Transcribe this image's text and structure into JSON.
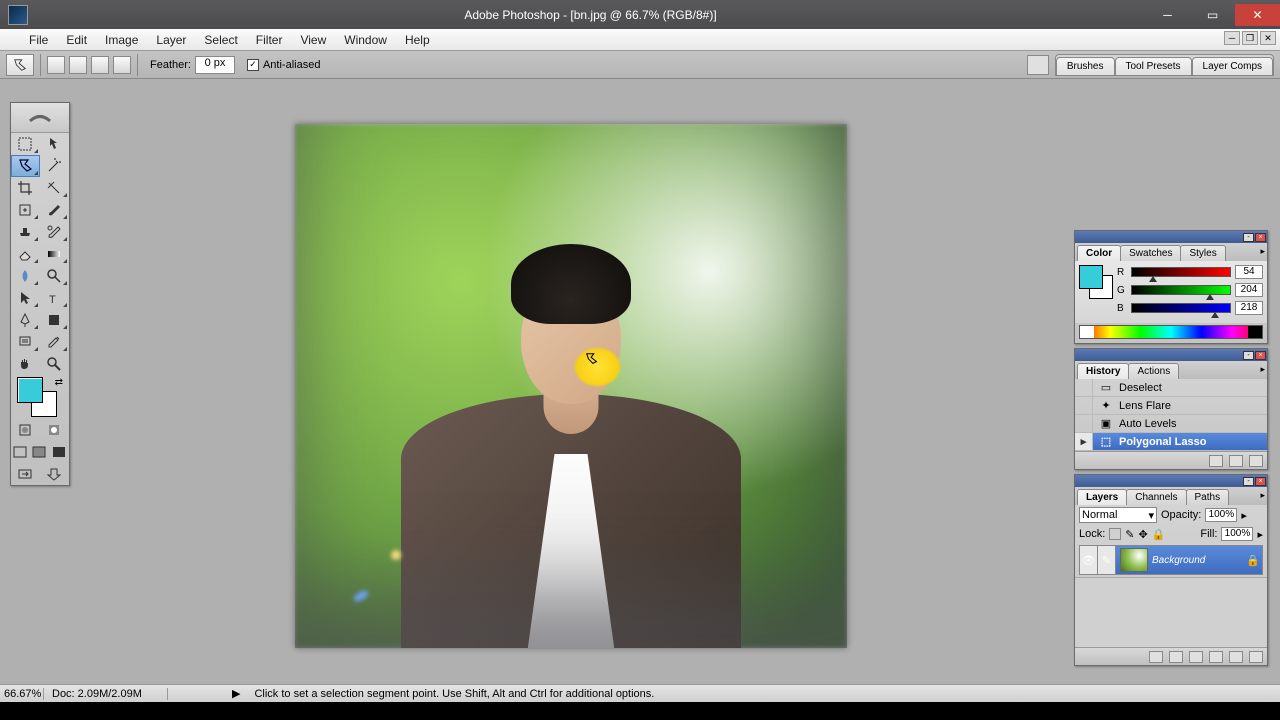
{
  "app": {
    "title": "Adobe Photoshop - [bn.jpg @ 66.7% (RGB/8#)]"
  },
  "menubar": {
    "items": [
      "File",
      "Edit",
      "Image",
      "Layer",
      "Select",
      "Filter",
      "View",
      "Window",
      "Help"
    ]
  },
  "options": {
    "feather_label": "Feather:",
    "feather_value": "0 px",
    "anti_aliased_label": "Anti-aliased",
    "dock_tabs": [
      "Brushes",
      "Tool Presets",
      "Layer Comps"
    ]
  },
  "color_panel": {
    "tabs": [
      "Color",
      "Swatches",
      "Styles"
    ],
    "rgb": {
      "R": 54,
      "G": 204,
      "B": 218
    },
    "foreground": "#36ccda",
    "background": "#ffffff"
  },
  "history_panel": {
    "tabs": [
      "History",
      "Actions"
    ],
    "items": [
      {
        "label": "Deselect",
        "active": false
      },
      {
        "label": "Lens Flare",
        "active": false
      },
      {
        "label": "Auto Levels",
        "active": false
      },
      {
        "label": "Polygonal Lasso",
        "active": true
      }
    ]
  },
  "layers_panel": {
    "tabs": [
      "Layers",
      "Channels",
      "Paths"
    ],
    "blend_mode": "Normal",
    "opacity_label": "Opacity:",
    "opacity_value": "100%",
    "lock_label": "Lock:",
    "fill_label": "Fill:",
    "fill_value": "100%",
    "layers": [
      {
        "name": "Background",
        "locked": true,
        "visible": true,
        "active": true
      }
    ]
  },
  "status": {
    "zoom": "66.67%",
    "doc_size": "Doc: 2.09M/2.09M",
    "hint": "Click to set a selection segment point.  Use Shift, Alt and Ctrl for additional options."
  }
}
